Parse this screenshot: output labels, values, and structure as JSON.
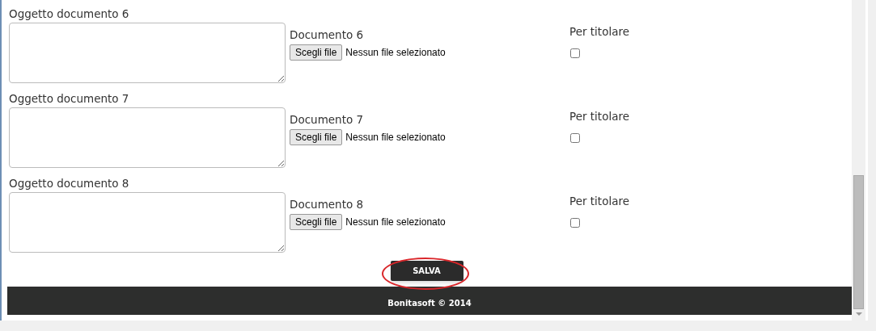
{
  "rows": [
    {
      "subject_label": "Oggetto documento 6",
      "file_label": "Documento 6",
      "file_button": "Scegli file",
      "file_status": "Nessun file selezionato",
      "owner_label": "Per titolare",
      "owner_checked": false
    },
    {
      "subject_label": "Oggetto documento 7",
      "file_label": "Documento 7",
      "file_button": "Scegli file",
      "file_status": "Nessun file selezionato",
      "owner_label": "Per titolare",
      "owner_checked": false
    },
    {
      "subject_label": "Oggetto documento 8",
      "file_label": "Documento 8",
      "file_button": "Scegli file",
      "file_status": "Nessun file selezionato",
      "owner_label": "Per titolare",
      "owner_checked": false
    }
  ],
  "save_button": "SALVA",
  "save_highlighted": true,
  "footer": "Bonitasoft © 2014"
}
